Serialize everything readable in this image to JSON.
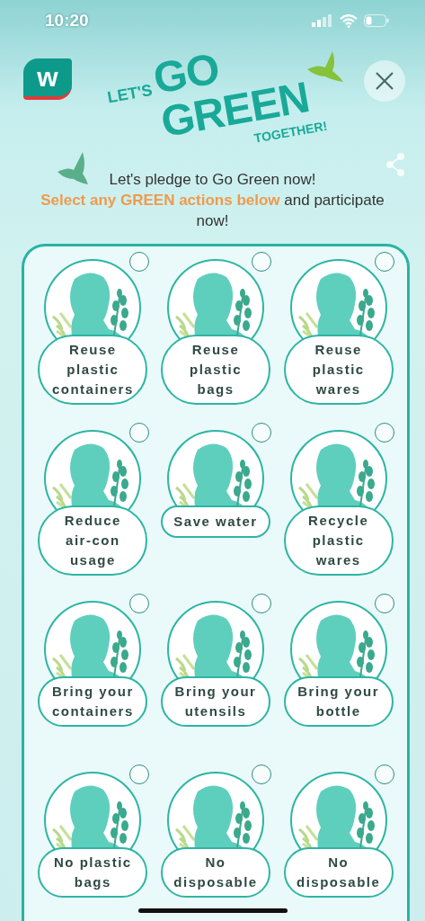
{
  "status_bar": {
    "time": "10:20"
  },
  "header": {
    "logo_text": "w",
    "title": [
      "LET'S",
      "GO",
      "GREEN",
      "TOGETHER!"
    ]
  },
  "intro": {
    "line": "Let's pledge to Go Green now!",
    "instruction": "**Select any GREEN actions below** and participate now!"
  },
  "actions": [
    {
      "label": "Reuse plastic containers",
      "selected": false
    },
    {
      "label": "Reuse plastic bags",
      "selected": false
    },
    {
      "label": "Reuse plastic wares",
      "selected": false
    },
    {
      "label": "Reduce air-con usage",
      "selected": false
    },
    {
      "label": "Save water",
      "selected": false
    },
    {
      "label": "Recycle plastic wares",
      "selected": false
    },
    {
      "label": "Bring your containers",
      "selected": false
    },
    {
      "label": "Bring your utensils",
      "selected": false
    },
    {
      "label": "Bring your bottle",
      "selected": false
    },
    {
      "label": "No plastic bags",
      "selected": false
    },
    {
      "label": "No disposable",
      "selected": false
    },
    {
      "label": "No disposable",
      "selected": false
    }
  ]
}
